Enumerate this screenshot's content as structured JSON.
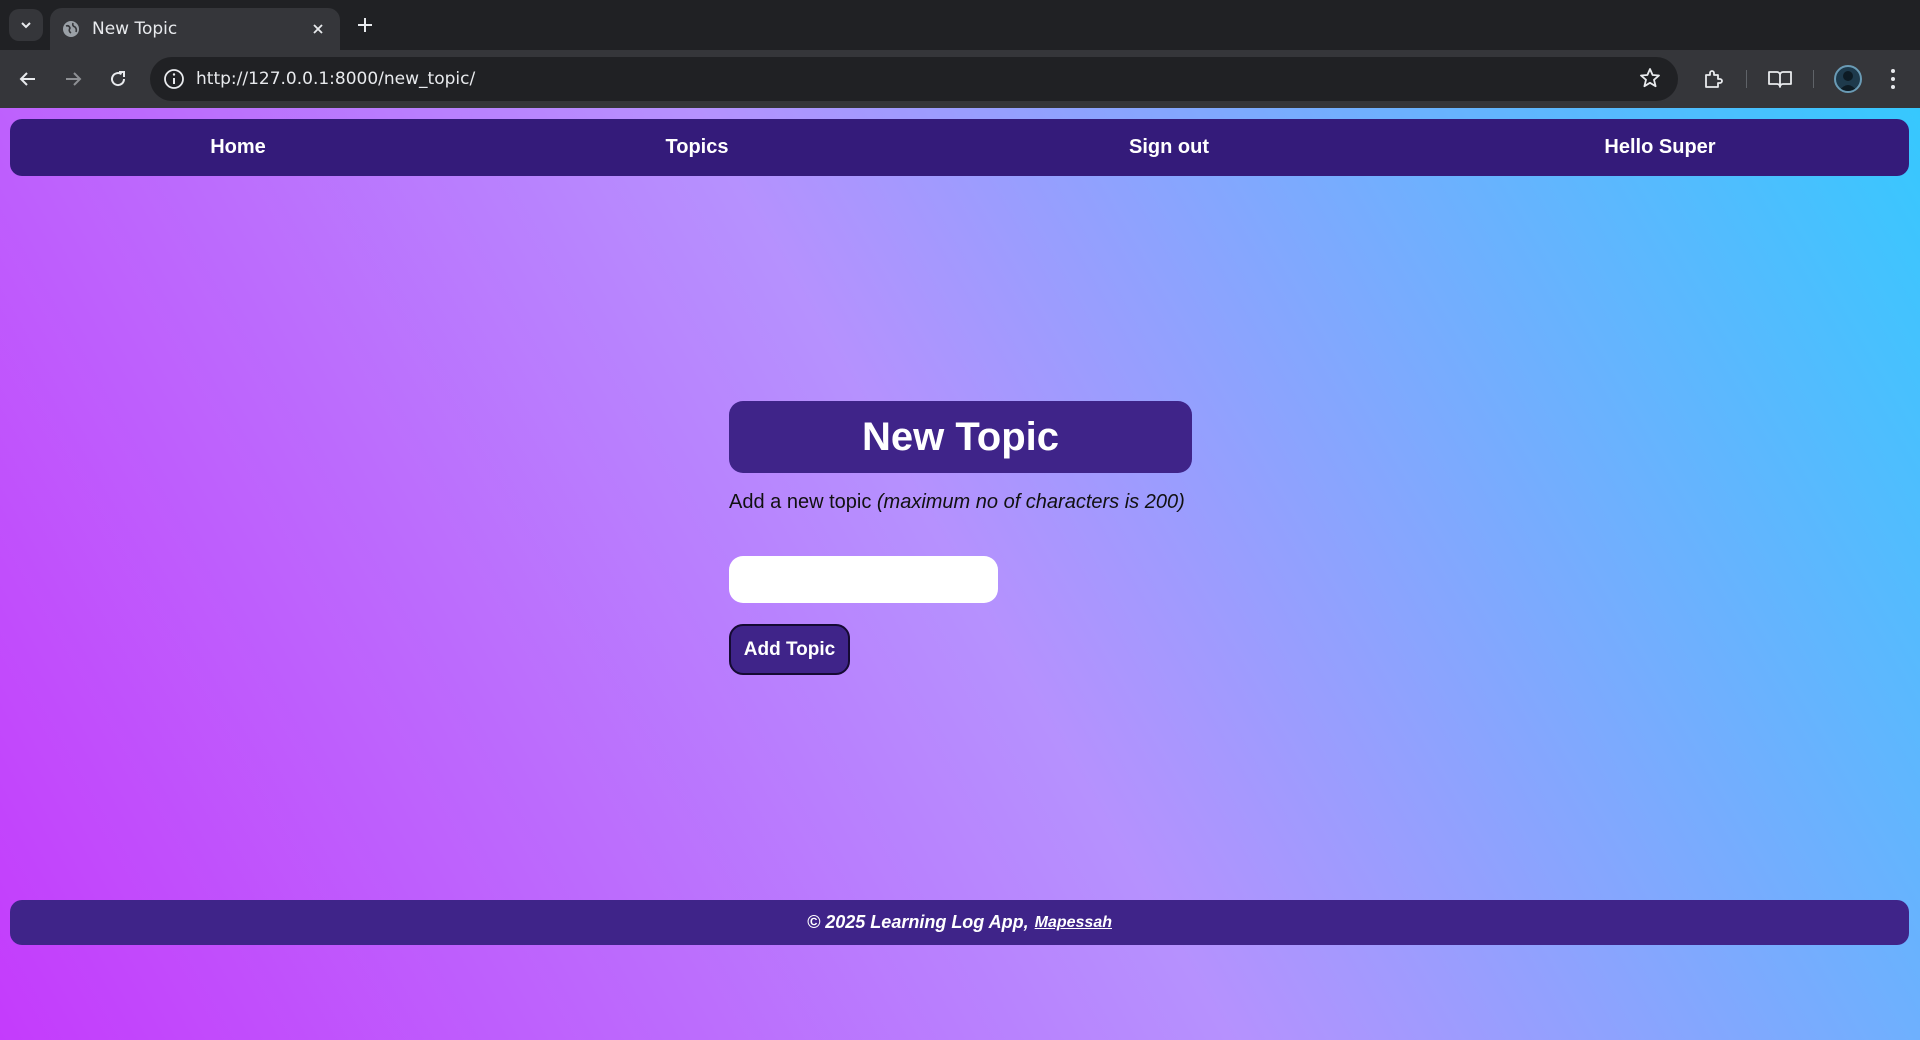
{
  "browser": {
    "tab_title": "New Topic",
    "url": "http://127.0.0.1:8000/new_topic/",
    "icons": [
      "tab-search-icon",
      "globe-icon",
      "close-icon",
      "new-tab-icon",
      "back-icon",
      "forward-icon",
      "reload-icon",
      "info-icon",
      "star-icon",
      "extensions-icon",
      "reading-mode-icon",
      "profile-avatar",
      "more-vert-icon"
    ]
  },
  "nav": {
    "home": "Home",
    "topics": "Topics",
    "signout": "Sign out",
    "greeting": "Hello Super"
  },
  "main": {
    "title": "New Topic",
    "hint_text": "Add a new topic ",
    "hint_note": "(maximum no of characters is 200)",
    "input_value": "",
    "submit_label": "Add Topic"
  },
  "footer": {
    "text": "© 2025 Learning Log App,",
    "author_link": "Mapessah"
  },
  "colors": {
    "nav_bg": "#341b7a",
    "accent": "#3f2489",
    "gradient_start": "#c43bfc",
    "gradient_mid": "#b691fe",
    "gradient_end": "#36c8fe"
  }
}
